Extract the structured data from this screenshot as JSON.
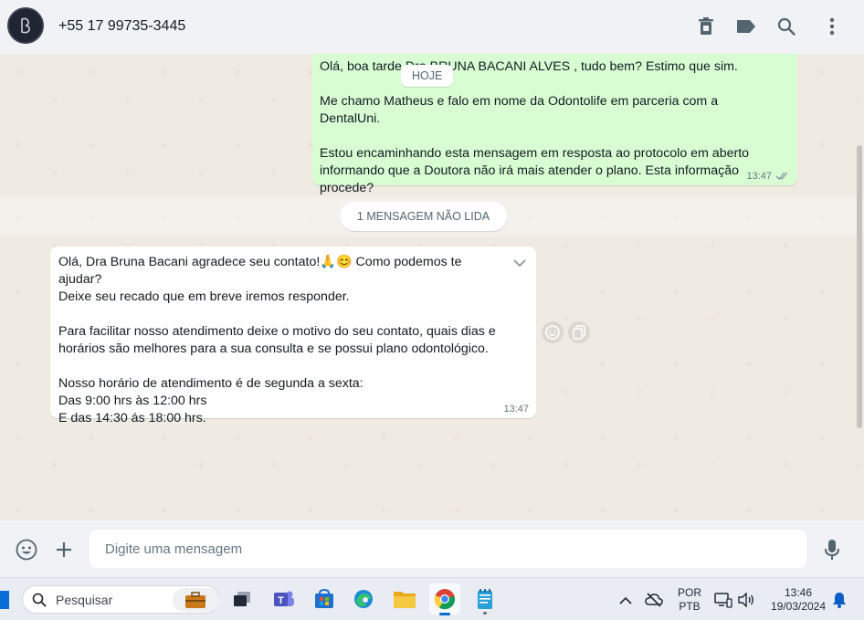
{
  "header": {
    "contact": "+55 17 99735-3445",
    "icons": [
      "trash-icon",
      "label-icon",
      "search-icon",
      "menu-icon"
    ]
  },
  "chat": {
    "date_chip": "HOJE",
    "outgoing": {
      "text": "Olá, boa tarde Dra BRUNA BACANI ALVES , tudo bem? Estimo que sim.\n\nMe chamo Matheus e falo em nome da Odontolife em parceria com a DentalUni.\n\nEstou encaminhando esta mensagem em resposta ao protocolo em aberto informando que a Doutora não irá mais atender o plano. Esta informação procede?",
      "time": "13:47",
      "status": "delivered"
    },
    "unread_label": "1 mensagem não lida",
    "incoming": {
      "text": "Olá, Dra Bruna Bacani agradece seu contato!🙏😊 Como podemos te ajudar?\nDeixe seu recado que em breve iremos responder.\n\nPara facilitar nosso atendimento deixe o motivo do seu contato, quais dias e horários são melhores para a sua consulta e se possui plano odontológico.\n\nNosso horário de atendimento é de segunda a sexta:\nDas 9:00 hrs às 12:00 hrs\nE das 14:30 ás 18:00 hrs.",
      "time": "13:47"
    }
  },
  "composer": {
    "placeholder": "Digite uma mensagem"
  },
  "taskbar": {
    "search_label": "Pesquisar",
    "language_line1": "POR",
    "language_line2": "PTB",
    "time": "13:46",
    "date": "19/03/2024"
  },
  "colors": {
    "outgoing_bubble": "#d9fdd3",
    "incoming_bubble": "#ffffff",
    "chat_background": "#efeae2",
    "header_background": "#f0f2f5"
  }
}
